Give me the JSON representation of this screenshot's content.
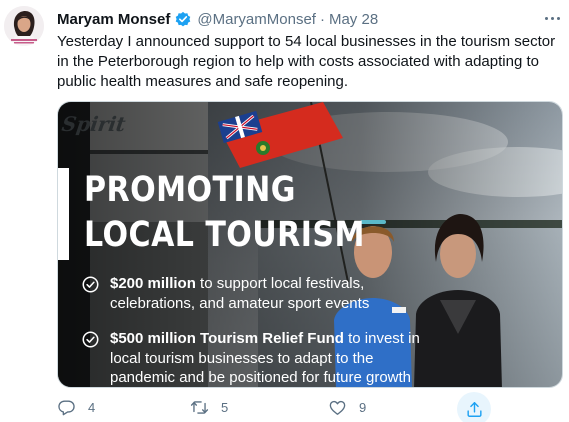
{
  "author": {
    "name": "Maryam Monsef",
    "handle": "@MaryamMonsef",
    "separator": "·",
    "date": "May 28",
    "verified": true
  },
  "tweet": {
    "text_lines": [
      "Yesterday I announced support to 54 local businesses in the tourism sector",
      "in the Peterborough region to help with costs associated with adapting to",
      "public health measures and safe reopening."
    ]
  },
  "media": {
    "boat_name": "Spirit",
    "headline_line1": "PROMOTING",
    "headline_line2": "LOCAL TOURISM",
    "bullet1": {
      "bold": "$200 million",
      "rest1": " to support local festivals,",
      "line2": "celebrations, and amateur sport events"
    },
    "bullet2": {
      "bold": "$500 million Tourism Relief Fund",
      "rest1": " to invest in",
      "line2": "local tourism businesses to adapt to the",
      "line3": "pandemic and be positioned for future growth"
    }
  },
  "actions": {
    "reply_count": "4",
    "retweet_count": "5",
    "like_count": "9"
  },
  "colors": {
    "accent": "#1da1f2",
    "secondary_text": "#5b7083",
    "border": "#cfd9de",
    "flag_red": "#d52b1e"
  },
  "icons": [
    "verified-badge-icon",
    "more-options-icon",
    "check-circle-icon",
    "reply-icon",
    "retweet-icon",
    "like-icon",
    "share-icon"
  ]
}
